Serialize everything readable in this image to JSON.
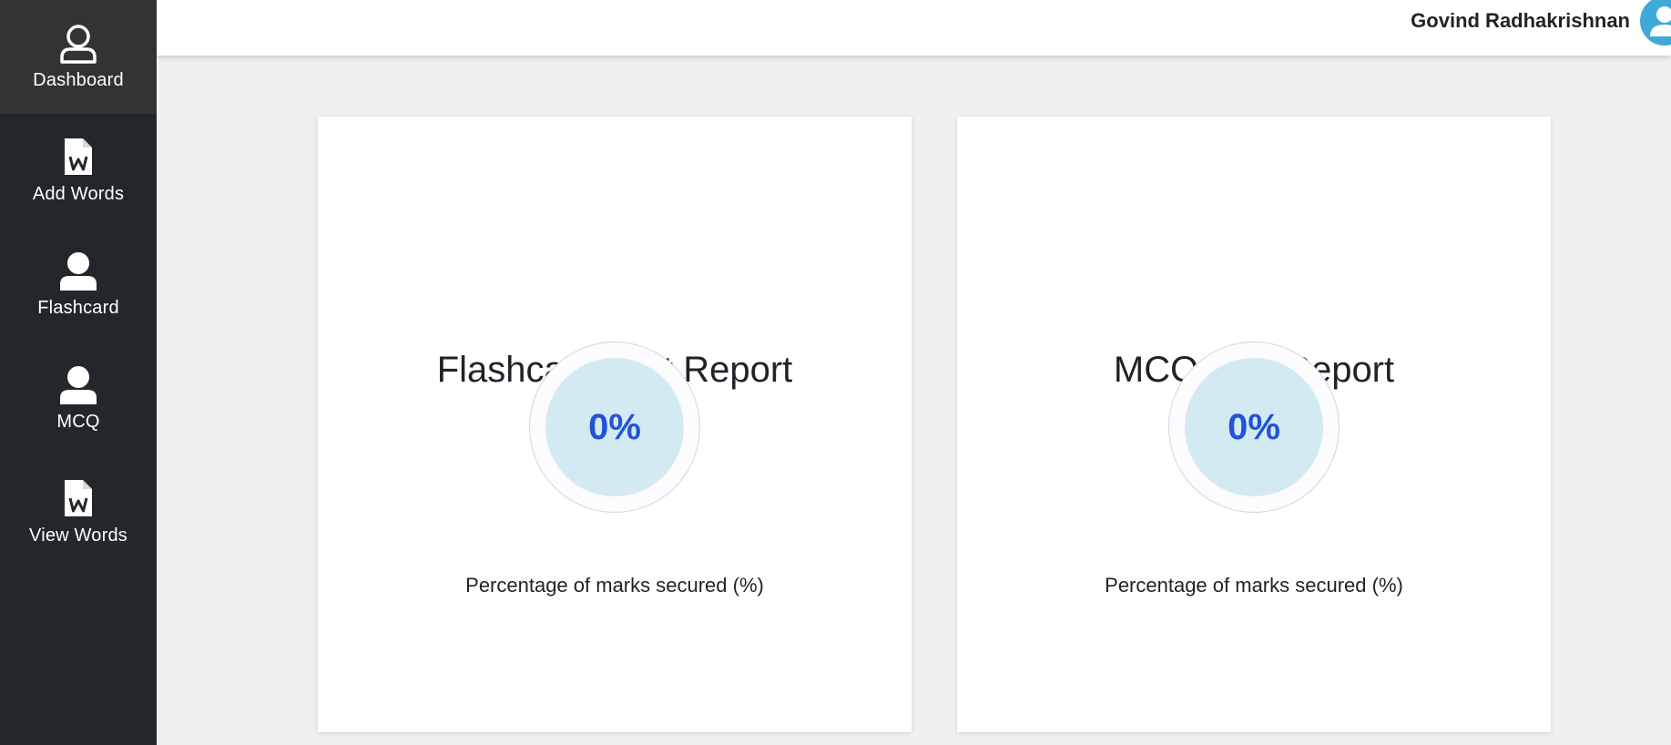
{
  "sidebar": {
    "items": [
      {
        "label": "Dashboard",
        "icon": "user-outline-icon",
        "active": true
      },
      {
        "label": "Add Words",
        "icon": "word-document-icon",
        "active": false
      },
      {
        "label": "Flashcard",
        "icon": "user-icon",
        "active": false
      },
      {
        "label": "MCQ",
        "icon": "user-icon",
        "active": false
      },
      {
        "label": "View Words",
        "icon": "word-document-icon",
        "active": false
      }
    ]
  },
  "header": {
    "user_name": "Govind Radhakrishnan",
    "avatar_icon": "user-avatar-icon"
  },
  "reports": [
    {
      "title": "Flashcard Test Report",
      "value": "0%",
      "caption": "Percentage of marks secured (%)"
    },
    {
      "title": "MCQ Test Report",
      "value": "0%",
      "caption": "Percentage of marks secured (%)"
    }
  ],
  "colors": {
    "sidebar_bg": "#23272b",
    "sidebar_active_bg": "#353232",
    "accent_text": "#2153d8",
    "gauge_fill": "#d4eaf2",
    "avatar": "#3fa9d8"
  }
}
